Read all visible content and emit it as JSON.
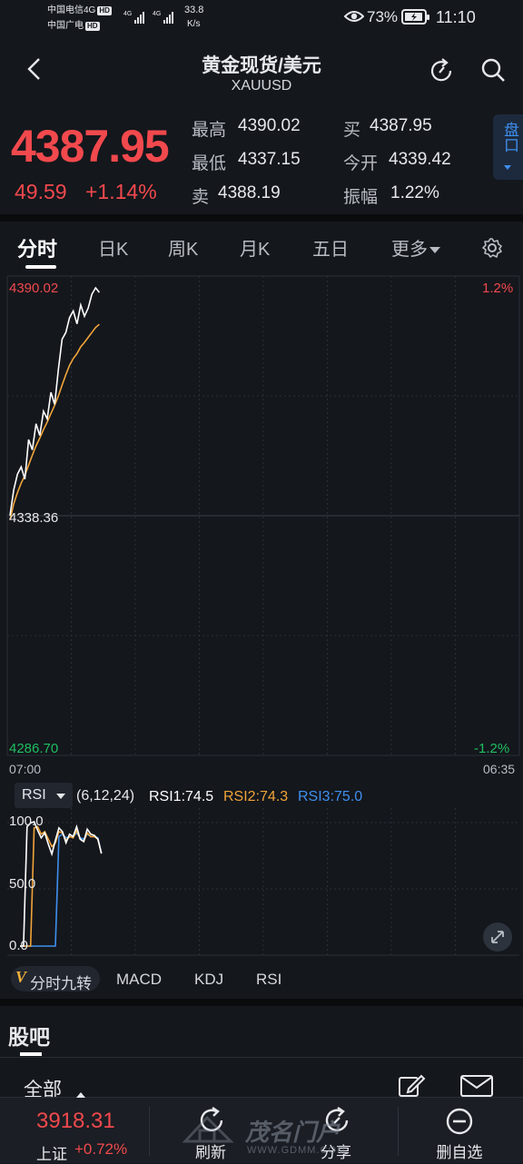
{
  "status_bar": {
    "carrier1": "中国电信4G",
    "carrier2": "中国广电",
    "hd": "HD",
    "net_speed": "33.8",
    "net_unit": "K/s",
    "battery": "73%",
    "time": "11:10",
    "signal1": "4G",
    "signal2": "4G"
  },
  "header": {
    "title": "黄金现货/美元",
    "subtitle": "XAUUSD"
  },
  "quote": {
    "price": "4387.95",
    "change": "49.59",
    "change_pct": "+1.14%",
    "high_label": "最高",
    "high": "4390.02",
    "low_label": "最低",
    "low": "4337.15",
    "sell_label": "卖",
    "sell": "4388.19",
    "buy_label": "买",
    "buy": "4387.95",
    "open_label": "今开",
    "open": "4339.42",
    "amplitude_label": "振幅",
    "amplitude": "1.22%",
    "panel_button": "盘口"
  },
  "tabs": [
    "分时",
    "日K",
    "周K",
    "月K",
    "五日",
    "更多"
  ],
  "chart_labels": {
    "y_top": "4390.02",
    "y_mid": "4338.36",
    "y_bottom": "4286.70",
    "pct_top": "1.2%",
    "pct_bottom": "-1.2%",
    "x_start": "07:00",
    "x_end": "06:35"
  },
  "chart_data": [
    {
      "type": "line",
      "title": "",
      "xlabel": "",
      "ylabel": "",
      "x_range": [
        "07:00",
        "06:35"
      ],
      "ylim": [
        4286.7,
        4390.02
      ],
      "grid": true,
      "series": [
        {
          "values": [
            4339.4,
            4345.1,
            4348.6,
            4350.2,
            4347.5,
            4356.3,
            4354.0,
            4359.8,
            4357.2,
            4362.6,
            4360.9,
            4366.8,
            4364.1,
            4371.9,
            4378.6,
            4380.1,
            4383.4,
            4384.9,
            4382.0,
            4386.2,
            4383.7,
            4385.5,
            4388.6,
            4390.02,
            4389.0
          ]
        },
        {
          "values": [
            4338.4,
            4342.0,
            4344.5,
            4346.6,
            4348.3,
            4350.6,
            4352.8,
            4354.9,
            4356.6,
            4358.5,
            4360.2,
            4362.1,
            4363.9,
            4366.0,
            4368.4,
            4370.7,
            4372.8,
            4374.3,
            4375.4,
            4376.9,
            4377.9,
            4379.0,
            4380.1,
            4381.2,
            4381.9
          ]
        }
      ]
    },
    {
      "type": "line",
      "title": "",
      "ylim": [
        0,
        100
      ],
      "y_ticks": [
        "100.0",
        "50.0",
        "0.0"
      ],
      "series": [
        {
          "name": "RSI1",
          "values": [
            0,
            0,
            96,
            99,
            100,
            93,
            87,
            91,
            82,
            74,
            85,
            95,
            92,
            83,
            90,
            88,
            96,
            86,
            84,
            94,
            90,
            89,
            86,
            74.5
          ]
        },
        {
          "name": "RSI2",
          "values": [
            0,
            0,
            0,
            0,
            95,
            96,
            90,
            92,
            86,
            80,
            83,
            92,
            91,
            85,
            88,
            87,
            93,
            86,
            84,
            91,
            88,
            88,
            86,
            74.3
          ]
        },
        {
          "name": "RSI3",
          "values": [
            0,
            0,
            0,
            0,
            0,
            0,
            0,
            0,
            0,
            0,
            0,
            88,
            90,
            87,
            88,
            88,
            91,
            87,
            86,
            90,
            88,
            88,
            87,
            75.0
          ]
        }
      ]
    }
  ],
  "rsi": {
    "selector": "RSI",
    "params": "(6,12,24)",
    "rsi1": "RSI1:74.5",
    "rsi2": "RSI2:74.3",
    "rsi3": "RSI3:75.0",
    "y_100": "100.0",
    "y_50": "50.0",
    "y_0": "0.0"
  },
  "indicator_tabs": {
    "jiuzhuan": "分时九转",
    "macd": "MACD",
    "kdj": "KDJ",
    "rsi": "RSI"
  },
  "forum": {
    "title": "股吧",
    "filter": "全部"
  },
  "bottom_bar": {
    "index_value": "3918.31",
    "index_name": "上证",
    "index_change": "+0.72%",
    "refresh": "刷新",
    "share": "分享",
    "remove": "删自选"
  },
  "watermark": {
    "name": "茂名门户",
    "url": "WWW.GDMM.COM"
  },
  "colors": {
    "up": "#f1494d",
    "down": "#1fbf61",
    "background": "#14171c",
    "rsi1": "#ffffff",
    "rsi2": "#f0a43a",
    "rsi3": "#3f8fef"
  }
}
